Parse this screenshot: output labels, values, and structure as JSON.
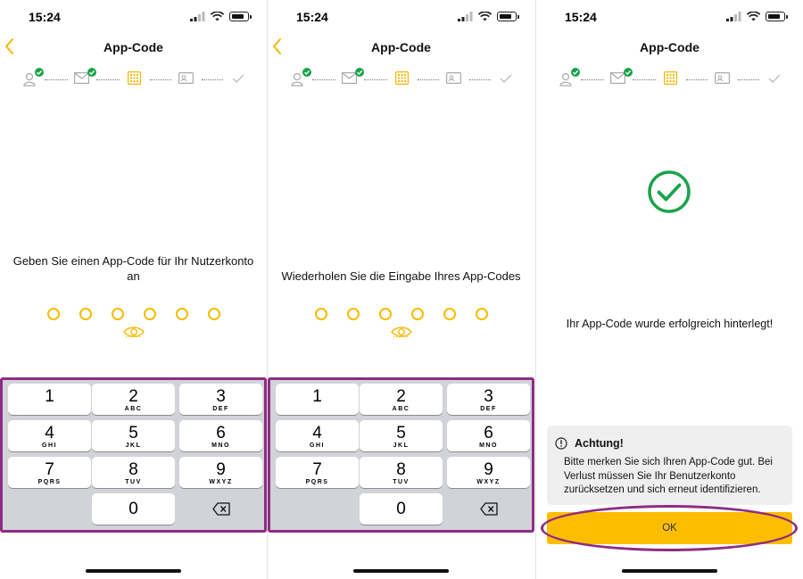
{
  "status": {
    "time": "15:24"
  },
  "nav": {
    "title": "App-Code"
  },
  "colors": {
    "accent": "#f5b800",
    "success": "#1aa34a",
    "highlight": "#8e2c82",
    "ok_button": "#fcbd00"
  },
  "stepper_icons": [
    "person-icon",
    "mail-icon",
    "keypad-icon",
    "id-card-icon",
    "checkmark-icon"
  ],
  "screens": [
    {
      "instruction": "Geben Sie einen App-Code für Ihr Nutzerkonto an",
      "pin_length": 6
    },
    {
      "instruction": "Wiederholen Sie die Eingabe Ihres App-Codes",
      "pin_length": 6
    },
    {
      "success_message": "Ihr App-Code wurde erfolgreich hinterlegt!",
      "warning_title": "Achtung!",
      "warning_body": "Bitte merken Sie sich Ihren App-Code gut. Bei Verlust müssen Sie Ihr Benutzerkonto zurücksetzen und sich erneut identifizieren.",
      "ok_label": "OK"
    }
  ],
  "keypad": {
    "keys": [
      {
        "num": "1",
        "letters": ""
      },
      {
        "num": "2",
        "letters": "ABC"
      },
      {
        "num": "3",
        "letters": "DEF"
      },
      {
        "num": "4",
        "letters": "GHI"
      },
      {
        "num": "5",
        "letters": "JKL"
      },
      {
        "num": "6",
        "letters": "MNO"
      },
      {
        "num": "7",
        "letters": "PQRS"
      },
      {
        "num": "8",
        "letters": "TUV"
      },
      {
        "num": "9",
        "letters": "WXYZ"
      }
    ],
    "zero": "0"
  }
}
